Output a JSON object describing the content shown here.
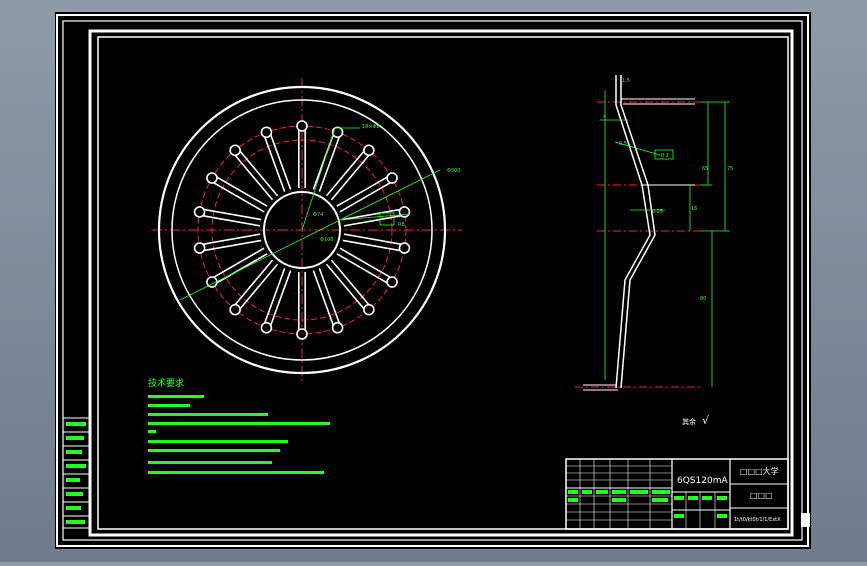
{
  "colors": {
    "canvas": "#000000",
    "frame": "#ffffff",
    "centerline": "#ff2020",
    "dimension": "#22ff22",
    "outline": "#ffffff",
    "note_text": "#22ff22"
  },
  "drawing": {
    "part_name": "6QS120mA",
    "university": "□□□大学",
    "title_block_name": "□□□",
    "drawing_number": "1t/t0/kt0t/1/1/ExtX",
    "notes_title": "技术要求",
    "surface_finish_symbol": "√",
    "surface_finish_label": "其余"
  },
  "front_view": {
    "spoke_count": 18,
    "annotations": {
      "top_hole": "18×Φ8",
      "diagonal_dim": "Φ300",
      "inner_dim": "Φ74",
      "section_dim": "R8",
      "center_dim": "Φ106"
    }
  },
  "side_view": {
    "annotations": {
      "top_angle": "1:5",
      "thickness": "4",
      "chamfer_top": "0.5",
      "geom_tol": "0.1",
      "dim_right_a": "75",
      "dim_right_b": "65",
      "dim_right_c": "16",
      "dim_small": "0.25",
      "dim_lower": "80"
    }
  }
}
